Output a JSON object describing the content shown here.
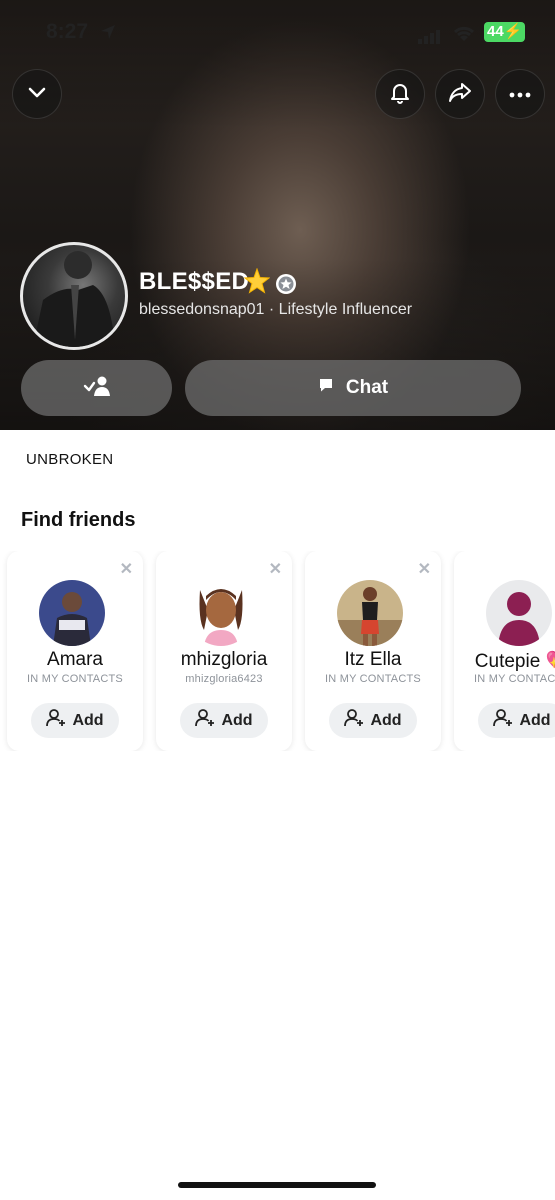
{
  "status_bar": {
    "time": "8:27",
    "battery": "44"
  },
  "profile": {
    "display_name": "BLE$$ED",
    "name_emoji": "🌟",
    "username": "blessedonsnap01",
    "separator": "·",
    "category": "Lifestyle Influencer",
    "bio": "UNBROKEN"
  },
  "actions": {
    "chat_label": "Chat"
  },
  "find_friends": {
    "title": "Find friends",
    "add_label": "Add",
    "items": [
      {
        "name": "Amara",
        "subtitle": "IN MY CONTACTS"
      },
      {
        "name": "mhizgloria",
        "subtitle": "mhizgloria6423"
      },
      {
        "name": "Itz Ella",
        "subtitle": "IN MY CONTACTS"
      },
      {
        "name": "Cutepie 💖",
        "subtitle": "IN MY CONTACTS"
      }
    ]
  },
  "icons": {
    "header_left": "chevron-down-icon",
    "header_right": [
      "bell-icon",
      "share-arrow-icon",
      "more-dots-icon"
    ],
    "friend_button": "friend-check-icon",
    "chat_button": "chat-bubble-icon",
    "card_close": "close-icon",
    "card_add": "add-friend-icon",
    "verified": "star-badge-icon"
  },
  "colors": {
    "hero_dark": "#1b1816",
    "pill": "#6e6e6e",
    "add_bg": "#eef0f2",
    "battery": "#4cd964",
    "muted": "#8e939a"
  }
}
